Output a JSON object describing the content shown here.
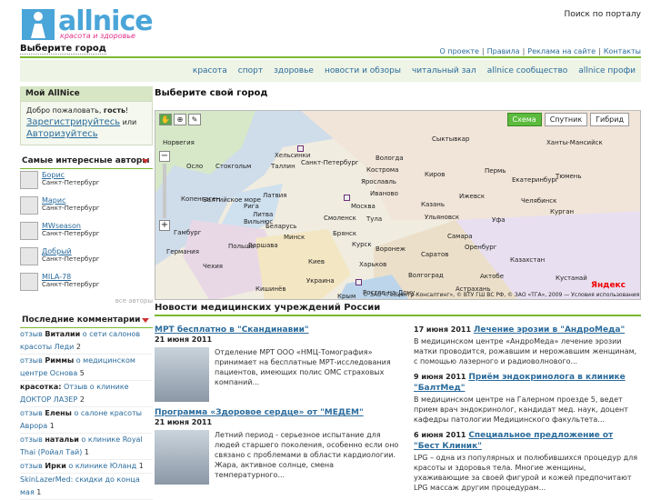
{
  "header": {
    "logo": "allnice",
    "tagline": "красота и здоровье",
    "portal_search": "Поиск по порталу",
    "city": "Выберите город",
    "links": [
      "О проекте",
      "Правила",
      "Реклама на сайте",
      "Контакты"
    ]
  },
  "nav": [
    "красота",
    "спорт",
    "здоровье",
    "новости и обзоры",
    "читальный зал",
    "allnice сообщество",
    "allnice профи"
  ],
  "mybox": {
    "title": "Мой AllNice",
    "welcome_pre": "Добро пожаловать,",
    "guest": "гость",
    "excl": "!",
    "register": "Зарегистрируйтесь",
    "or": "или",
    "login": "Авторизуйтесь"
  },
  "authors": {
    "title": "Самые интересные авторы",
    "items": [
      {
        "name": "Борис",
        "city": "Санкт-Петербург"
      },
      {
        "name": "Марис",
        "city": "Санкт-Петербург"
      },
      {
        "name": "MWseason",
        "city": "Санкт-Петербург"
      },
      {
        "name": "Добрый",
        "city": "Санкт-Петербург"
      },
      {
        "name": "MILA-78",
        "city": "Санкт-Петербург"
      }
    ],
    "more": "все авторы"
  },
  "comments": {
    "title": "Последние комментарии",
    "items": [
      {
        "a": "отзыв",
        "who": "Виталии",
        "b": "о сети салонов",
        "c": "красоты Леди",
        "n": "2"
      },
      {
        "a": "отзыв",
        "who": "Риммы",
        "b": "о медицинском",
        "c": "центре Основа",
        "n": "5"
      },
      {
        "a": "красотка:",
        "who": "",
        "b": "Отзыв о клинике",
        "c": "ДОКТОР ЛАЗЕР",
        "n": "2"
      },
      {
        "a": "отзыв",
        "who": "Елены",
        "b": "о салоне красоты",
        "c": "Аврора",
        "n": "1"
      },
      {
        "a": "отзыв",
        "who": "натальи",
        "b": "о клинике Royal",
        "c": "Thai (Ройал Тай)",
        "n": "1"
      },
      {
        "a": "отзыв",
        "who": "Ирки",
        "b": "о клинике Юланд",
        "c": "",
        "n": "1"
      },
      {
        "a": "SkinLazerMed:",
        "who": "",
        "b": "скидки до конца мая",
        "c": "",
        "n": "1"
      }
    ]
  },
  "map": {
    "title": "Выберите свой город",
    "modes": [
      "Схема",
      "Спутник",
      "Гибрид"
    ],
    "labels": [
      "Норвегия",
      "Сыктывкар",
      "Ханты-Мансийск",
      "Хельсинки",
      "Вологда",
      "Осло",
      "Стокгольм",
      "Таллин",
      "Санкт-Петербург",
      "Кострома",
      "Пермь",
      "Ярославль",
      "Киров",
      "Екатеринбург",
      "Тюмень",
      "Латвия",
      "Рига",
      "Литва",
      "Москва",
      "Иваново",
      "Ижевск",
      "Челябинск",
      "Копенгаген",
      "Балтийское море",
      "Казань",
      "Курган",
      "Вильнюс",
      "Беларусь",
      "Смоленск",
      "Тула",
      "Ульяновск",
      "Уфа",
      "Гамбург",
      "Минск",
      "Брянск",
      "Самара",
      "Оренбург",
      "Германия",
      "Польша",
      "Варшава",
      "Курск",
      "Воронеж",
      "Саратов",
      "Киев",
      "Харьков",
      "Казахстан",
      "Чехия",
      "Украина",
      "Волгоград",
      "Актобе",
      "Кустанай",
      "Ростов-на-Дону",
      "Астрахань",
      "Кишинёв",
      "Крым"
    ],
    "copyright": "© ЗАО «Геоцентр-Консалтинг», © ВТУ ГШ ВС РФ, © ЗАО «ТГА», 2009 — Условия использования",
    "yandex": "Яндекс"
  },
  "news": {
    "title": "Новости медицинских учреждений России",
    "left": [
      {
        "title": "МРТ бесплатно в \"Скандинавии\"",
        "date": "21 июня 2011",
        "text": "Отделение МРТ ООО «НМЦ-Томография» принимает на бесплатные МРТ-исследования пациентов, имеющих полис ОМС страховых компаний..."
      },
      {
        "title": "Программа «Здоровое сердце» от \"МЕДЕМ\"",
        "date": "21 июня 2011",
        "text": "Летний период - серьезное испытание для людей старшего поколения, особенно если оно связано с проблемами в области кардиологии. Жара, активное солнце, смена температурного..."
      }
    ],
    "right": [
      {
        "date": "17 июня 2011",
        "title": "Лечение эрозии в \"АндроМеда\"",
        "text": "В медицинском центре «АндроМеда» лечение эрозии матки проводится, рожавшим и нерожавшим женщинам, с помощью лазерного и радиоволнового..."
      },
      {
        "date": "9 июня 2011",
        "title": "Приём эндокринолога в клинике \"БалтМед\"",
        "text": "В медицинском центре на Галерном проезде 5, ведет прием врач эндокринолог, кандидат мед. наук, доцент кафедры патологии Медицинского факультета..."
      },
      {
        "date": "6 июня 2011",
        "title": "Специальное предложение от \"Бест Клиник\"",
        "text": "LPG – одна из популярных и полюбившихся процедур для красоты и здоровья тела. Многие женщины, ухаживающие за своей фигурой и кожей предпочитают LPG массаж другим процедурам..."
      }
    ]
  }
}
